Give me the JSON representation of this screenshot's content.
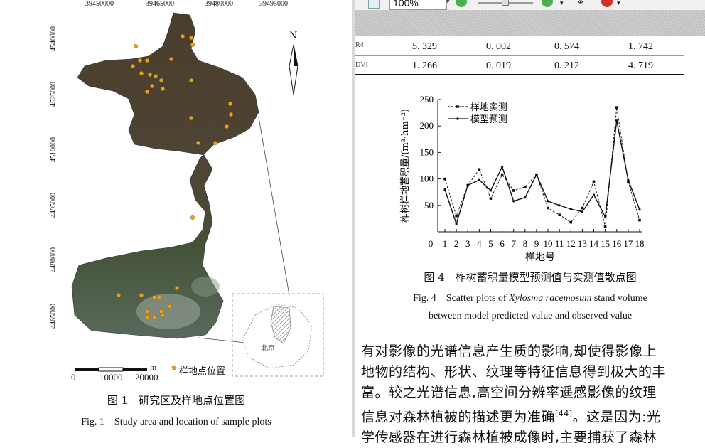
{
  "left_figure": {
    "top_coords": [
      "39450000",
      "39465000",
      "39480000",
      "39495000"
    ],
    "left_coords": [
      "4540000",
      "4525000",
      "4510000",
      "4495000",
      "4480000",
      "4465000"
    ],
    "north_label": "N",
    "beijing_label": "北京",
    "scale_unit": "m",
    "scale_ticks": [
      "0",
      "10000",
      "20000"
    ],
    "legend_label": "样地点位置",
    "caption_cn": "图 1　研究区及样地点位置图",
    "caption_en": "Fig. 1　Study area and location of sample plots"
  },
  "toolbar": {
    "zoom": "100%"
  },
  "table_rows": [
    {
      "label": "R4",
      "values": [
        "5. 329",
        "0. 002",
        "0. 574",
        "1. 742"
      ]
    },
    {
      "label": "DVI",
      "values": [
        "1. 266",
        "0. 019",
        "0. 212",
        "4. 719"
      ]
    }
  ],
  "chart_data": {
    "type": "line",
    "ylabel": "柞树样地蓄积量/(m³·hm⁻²)",
    "xlabel": "样地号",
    "x": [
      "1",
      "2",
      "3",
      "4",
      "5",
      "6",
      "7",
      "8",
      "9",
      "10",
      "11",
      "12",
      "13",
      "14",
      "15",
      "16",
      "17",
      "18"
    ],
    "y_ticks": [
      "50",
      "100",
      "150",
      "200",
      "250"
    ],
    "x_axis_zero": "0",
    "ylim": [
      0,
      250
    ],
    "legend_position": "top-left",
    "series": [
      {
        "name": "样地实测",
        "style": "dashed",
        "values": [
          100,
          30,
          88,
          118,
          63,
          108,
          78,
          85,
          108,
          45,
          32,
          18,
          45,
          95,
          10,
          235,
          95,
          22
        ]
      },
      {
        "name": "模型预测",
        "style": "solid",
        "values": [
          80,
          15,
          88,
          98,
          78,
          123,
          58,
          65,
          108,
          58,
          50,
          43,
          38,
          70,
          28,
          210,
          98,
          42
        ]
      }
    ],
    "colors": {
      "series": "#111111"
    }
  },
  "right_figure": {
    "caption_cn": "图 4　柞树蓄积量模型预测值与实测值散点图",
    "caption_en_prefix": "Fig. 4　Scatter plots of ",
    "caption_en_italic": "Xylosma racemosum",
    "caption_en_suffix": " stand volume",
    "caption_en_line2": "between model predicted value and observed value"
  },
  "body_text": {
    "line1": "有对影像的光谱信息产生质的影响,却使得影像上",
    "line2": "地物的结构、形状、纹理等特征信息得到极大的丰",
    "line3": "富。较之光谱信息,高空间分辨率遥感影像的纹理",
    "line4_main": "信息对森林植被的描述更为准确",
    "line4_ref": "[44]",
    "line4_tail": "。这是因为:光",
    "line5": "学传感器在进行森林植被成像时,主要捕获了森林"
  }
}
